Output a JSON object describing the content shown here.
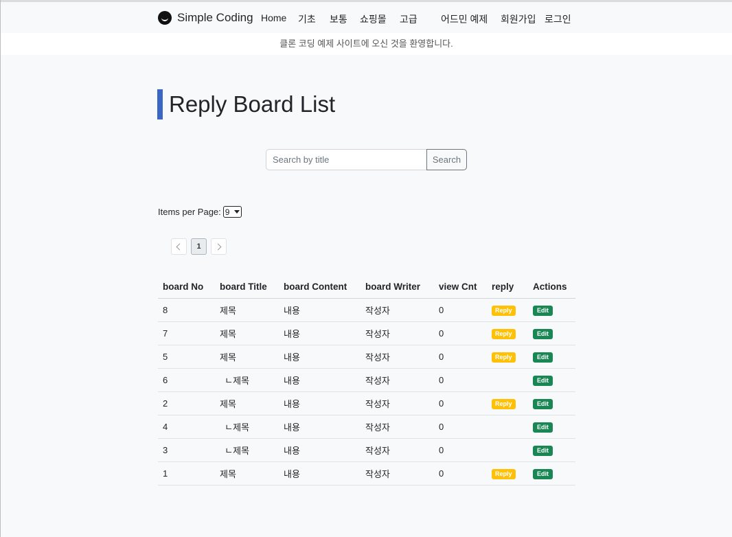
{
  "brand": {
    "name": "Simple Coding",
    "icon": "brand-logo-icon"
  },
  "nav": {
    "home": "Home",
    "basic": "기초",
    "normal": "보통",
    "shop": "쇼핑몰",
    "advanced": "고급",
    "admin": "어드민 예제",
    "signup": "회원가입",
    "login": "로그인"
  },
  "notice": "클론 코딩 예제 사이트에 오신 것을 환영합니다.",
  "page": {
    "title": "Reply Board List",
    "accent_color": "#3a66c4"
  },
  "search": {
    "placeholder": "Search by title",
    "value": "",
    "button": "Search"
  },
  "items_per_page": {
    "label": "Items per Page:",
    "selected": "9"
  },
  "pagination": {
    "current": "1"
  },
  "table": {
    "headers": [
      "board No",
      "board Title",
      "board Content",
      "board Writer",
      "view Cnt",
      "reply",
      "Actions"
    ],
    "rows": [
      {
        "no": "8",
        "title": "제목",
        "content": "내용",
        "writer": "작성자",
        "views": "0",
        "reply": "Reply",
        "action": "Edit"
      },
      {
        "no": "7",
        "title": "제목",
        "content": "내용",
        "writer": "작성자",
        "views": "0",
        "reply": "Reply",
        "action": "Edit"
      },
      {
        "no": "5",
        "title": "제목",
        "content": "내용",
        "writer": "작성자",
        "views": "0",
        "reply": "Reply",
        "action": "Edit"
      },
      {
        "no": "6",
        "title": "  ㄴ제목",
        "content": "내용",
        "writer": "작성자",
        "views": "0",
        "reply": "",
        "action": "Edit"
      },
      {
        "no": "2",
        "title": "제목",
        "content": "내용",
        "writer": "작성자",
        "views": "0",
        "reply": "Reply",
        "action": "Edit"
      },
      {
        "no": "4",
        "title": "  ㄴ제목",
        "content": "내용",
        "writer": "작성자",
        "views": "0",
        "reply": "",
        "action": "Edit"
      },
      {
        "no": "3",
        "title": "  ㄴ제목",
        "content": "내용",
        "writer": "작성자",
        "views": "0",
        "reply": "",
        "action": "Edit"
      },
      {
        "no": "1",
        "title": "제목",
        "content": "내용",
        "writer": "작성자",
        "views": "0",
        "reply": "Reply",
        "action": "Edit"
      }
    ]
  },
  "colors": {
    "reply": "#ffc107",
    "edit": "#198754"
  }
}
